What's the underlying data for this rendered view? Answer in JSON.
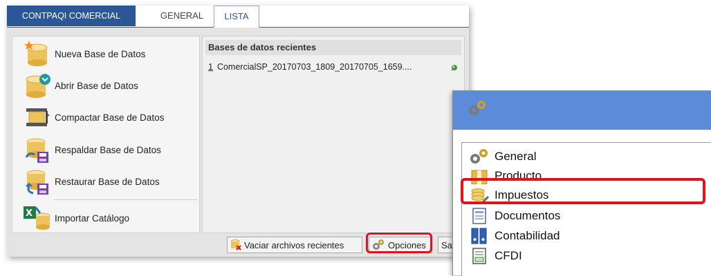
{
  "window": {
    "tabs": [
      {
        "label": "CONTPAQI COMERCIAL"
      },
      {
        "label": "GENERAL"
      },
      {
        "label": "LISTA"
      }
    ],
    "menu": [
      {
        "label": "Nueva Base de Datos",
        "icon": "new-database-icon"
      },
      {
        "label": "Abrir Base de Datos",
        "icon": "open-database-icon"
      },
      {
        "label": "Compactar Base de Datos",
        "icon": "compact-database-icon"
      },
      {
        "label": "Respaldar Base de Datos",
        "icon": "backup-database-icon"
      },
      {
        "label": "Restaurar Base de Datos",
        "icon": "restore-database-icon"
      },
      {
        "label": "Importar Catálogo",
        "icon": "excel-import-icon"
      }
    ],
    "recent": {
      "header": "Bases de datos recientes",
      "items": [
        {
          "num": "1",
          "name": "ComercialSP_20170703_1809_20170705_1659...."
        }
      ]
    },
    "footer": {
      "vaciar_label": "Vaciar archivos recientes",
      "opciones_label": "Opciones",
      "sa_label": "Sa"
    }
  },
  "options_window": {
    "items": [
      {
        "label": "General",
        "icon": "gears-icon"
      },
      {
        "label": "Producto",
        "icon": "box-icon"
      },
      {
        "label": "Impuestos",
        "icon": "coins-icon"
      },
      {
        "label": "Documentos",
        "icon": "document-icon"
      },
      {
        "label": "Contabilidad",
        "icon": "binders-icon"
      },
      {
        "label": "CFDI",
        "icon": "cfdi-document-icon"
      }
    ]
  },
  "colors": {
    "accent": "#2b5797",
    "options_title": "#5b8bd9",
    "highlight": "#e3101d"
  }
}
